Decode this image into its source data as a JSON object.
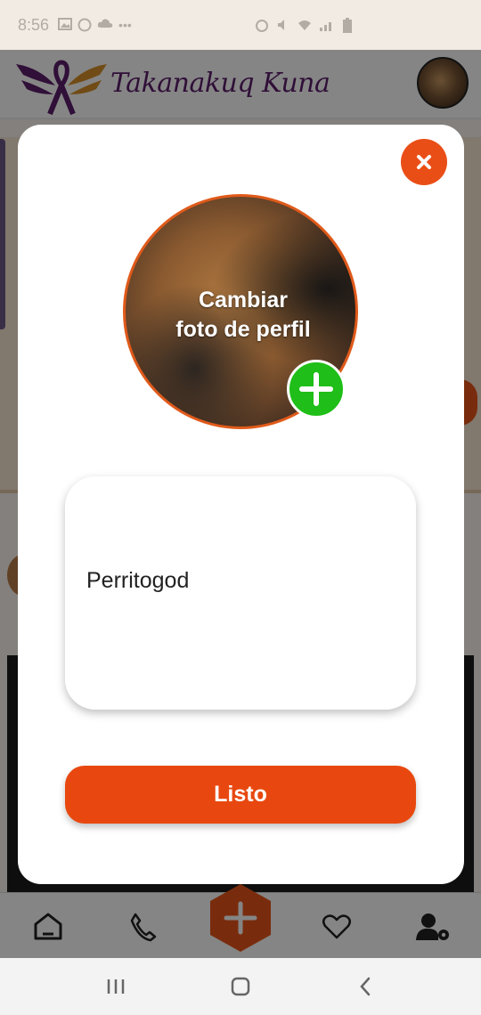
{
  "status_bar": {
    "time": "8:56"
  },
  "app": {
    "brand_name": "Takanakuq Kuna",
    "nav_items": [
      {
        "icon": "home-icon"
      },
      {
        "icon": "phone-icon"
      },
      {
        "icon": "plus-icon"
      },
      {
        "icon": "heart-icon"
      },
      {
        "icon": "user-settings-icon"
      }
    ]
  },
  "modal": {
    "change_photo_label_line1": "Cambiar",
    "change_photo_label_line2": "foto de perfil",
    "name_value": "Perritogod",
    "done_label": "Listo",
    "close_icon": "close-icon",
    "add_icon": "plus-icon"
  },
  "colors": {
    "accent": "#e8480f",
    "add_button": "#1fbe18",
    "brand_purple": "#5c1e6b"
  }
}
